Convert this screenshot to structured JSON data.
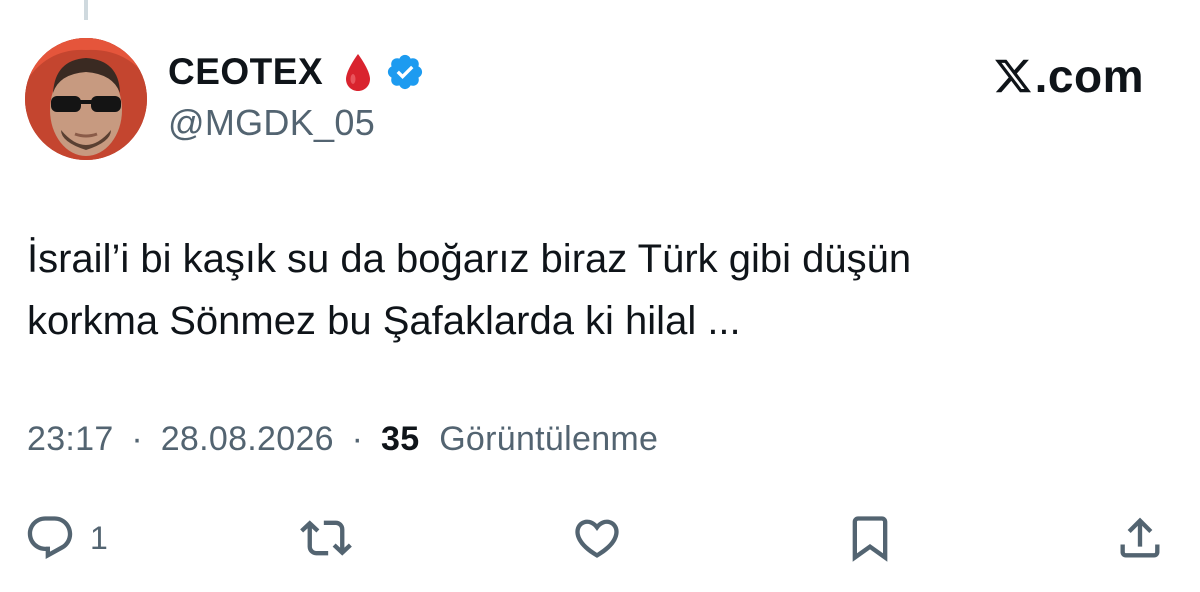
{
  "author": {
    "display_name": "CEOTEX",
    "handle": "@MGDK_05",
    "badge_icon": "drop-of-blood-icon",
    "verified_icon": "verified-badge-icon",
    "verified_color": "#1d9bf0",
    "drop_color": "#d9232e"
  },
  "brand": {
    "label": ".com",
    "logo_icon": "x-logo-icon"
  },
  "tweet": {
    "lines": [
      "İsrail’i bi kaşık su da boğarız biraz Türk gibi düşün",
      "korkma Sönmez bu Şafaklarda ki hilal ..."
    ]
  },
  "meta": {
    "time": "23:17",
    "separator": "·",
    "date": "28.08.2026",
    "views_count": "35",
    "views_label": "Görüntülenme"
  },
  "actions": {
    "reply_count": "1",
    "icons": [
      "reply-icon",
      "retweet-icon",
      "like-icon",
      "bookmark-icon",
      "share-icon"
    ]
  },
  "colors": {
    "text_primary": "#0f1419",
    "text_secondary": "#536471",
    "icon": "#536471"
  }
}
